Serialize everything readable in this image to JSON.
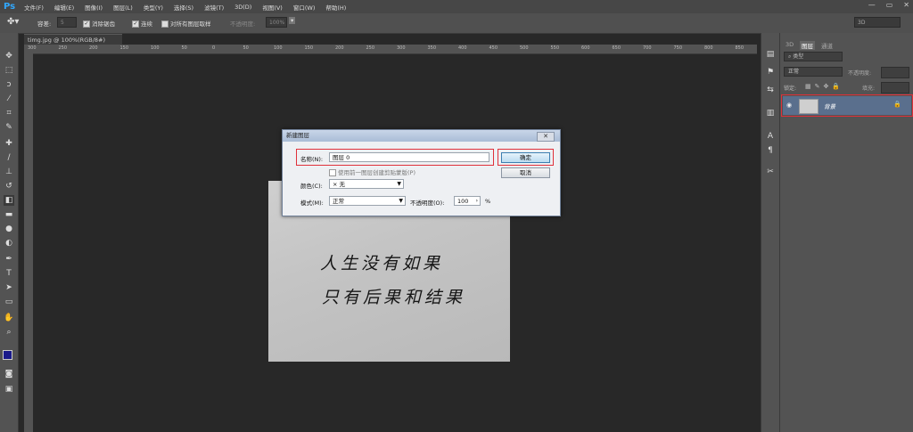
{
  "app": {
    "logo": "Ps"
  },
  "menu": [
    "文件(F)",
    "编辑(E)",
    "图像(I)",
    "图层(L)",
    "类型(Y)",
    "选择(S)",
    "滤镜(T)",
    "3D(D)",
    "视图(V)",
    "窗口(W)",
    "帮助(H)"
  ],
  "window_controls": {
    "minimize": "—",
    "restore": "▭",
    "close": "✕"
  },
  "options": {
    "brush_size_label": "容差:",
    "brush_size_value": "5",
    "antialias": "消除锯齿",
    "contiguous": "连续",
    "sample_all": "对所有图层取样",
    "opacity_label": "不透明度:",
    "opacity_value": "100%",
    "workspace": "3D"
  },
  "document": {
    "tab_title": "timg.jpg @ 100%(RGB/8#)"
  },
  "ruler": {
    "top_ticks": [
      "300",
      "250",
      "200",
      "150",
      "100",
      "50",
      "0",
      "50",
      "100",
      "150",
      "200",
      "250",
      "300",
      "350",
      "400",
      "450",
      "500",
      "550",
      "600",
      "650",
      "700",
      "750",
      "800",
      "850"
    ]
  },
  "canvas_text": {
    "line1": "人生没有如果",
    "line2": "只有后果和结果"
  },
  "layers_panel": {
    "tabs": [
      "3D",
      "图层",
      "通道"
    ],
    "kind_label": "类型",
    "blend_mode": "正常",
    "opacity_label": "不透明度:",
    "lock_label": "锁定:",
    "fill_label": "填充:",
    "layer_name": "背景"
  },
  "dialog": {
    "title": "新建图层",
    "name_label": "名称(N):",
    "name_value": "图层 0",
    "clip_label": "使用前一图层创建剪贴蒙版(P)",
    "color_label": "颜色(C):",
    "color_value": "× 无",
    "mode_label": "模式(M):",
    "mode_value": "正常",
    "opacity_label": "不透明度(O):",
    "opacity_value": "100",
    "opacity_unit": "%",
    "ok": "确定",
    "cancel": "取消",
    "close": "✕"
  },
  "colors": {
    "foreground": "#1a1a8a",
    "background": "#ffffff",
    "highlight": "#e0303a",
    "layer_selected": "#5a6f8d"
  }
}
